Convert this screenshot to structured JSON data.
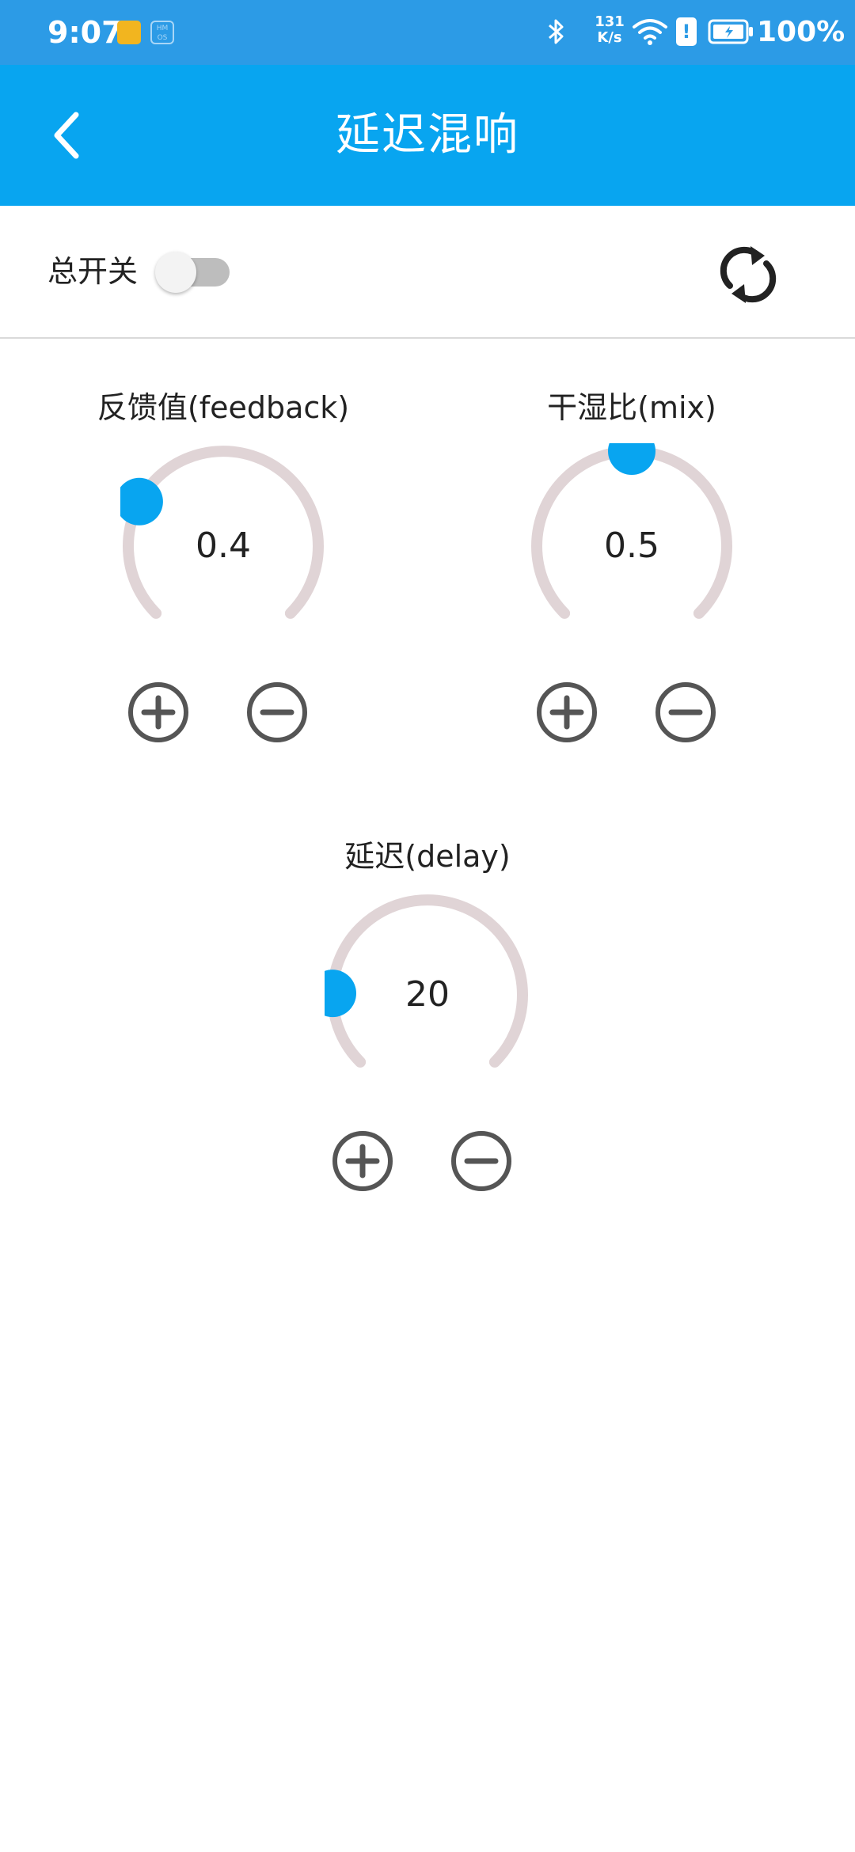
{
  "status_bar": {
    "time": "9:07",
    "net_speed_value": "131",
    "net_speed_unit": "K/s",
    "battery_percent": "100%",
    "colors": {
      "background": "#2c9be6"
    }
  },
  "app_bar": {
    "title": "延迟混响",
    "back_icon": "chevron-left-icon",
    "colors": {
      "background": "#08a5f0"
    }
  },
  "controls": {
    "master_switch_label": "总开关",
    "master_switch_on": false,
    "reset_icon": "refresh-icon"
  },
  "knobs": [
    {
      "id": "feedback",
      "title": "反馈值(feedback)",
      "value": "0.4",
      "level": 0.27
    },
    {
      "id": "mix",
      "title": "干湿比(mix)",
      "value": "0.5",
      "level": 0.5
    },
    {
      "id": "delay",
      "title": "延迟(delay)",
      "value": "20",
      "level": 0.17
    }
  ],
  "colors": {
    "accent": "#08a5f0",
    "track": "#e0d4d6",
    "button_stroke": "#555555"
  }
}
